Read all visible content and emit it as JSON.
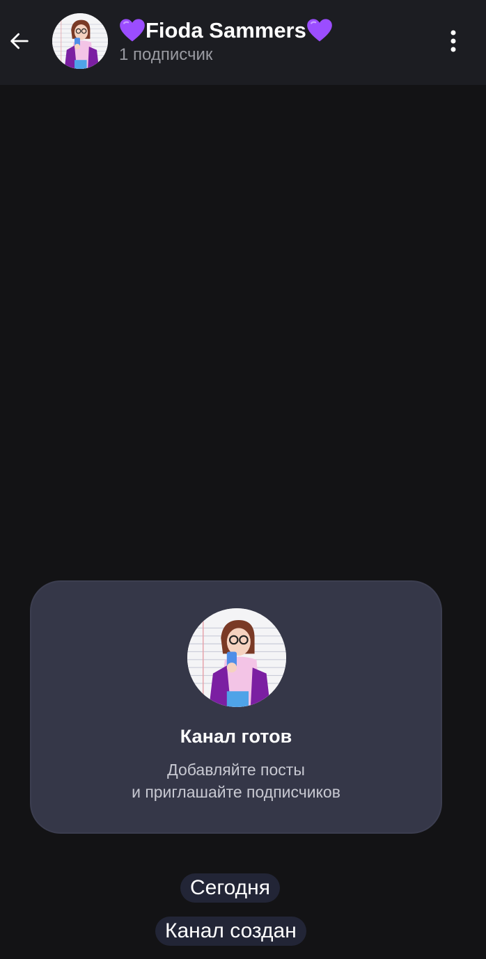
{
  "header": {
    "title": "Fioda Sammers",
    "subtitle": "1 подписчик",
    "heart_color": "#9b4dff"
  },
  "card": {
    "title": "Канал готов",
    "line1": "Добавляйте посты",
    "line2": "и приглашайте подписчиков"
  },
  "service": {
    "date_pill": "Сегодня",
    "created_pill": "Канал создан"
  },
  "colors": {
    "background": "#131315",
    "header": "#1c1d22",
    "card": "#353748",
    "pill": "#222536",
    "subtitle": "#9a9ba2"
  },
  "icons": {
    "back": "arrow-left-icon",
    "menu": "more-vertical-icon",
    "heart": "purple-heart-icon"
  }
}
